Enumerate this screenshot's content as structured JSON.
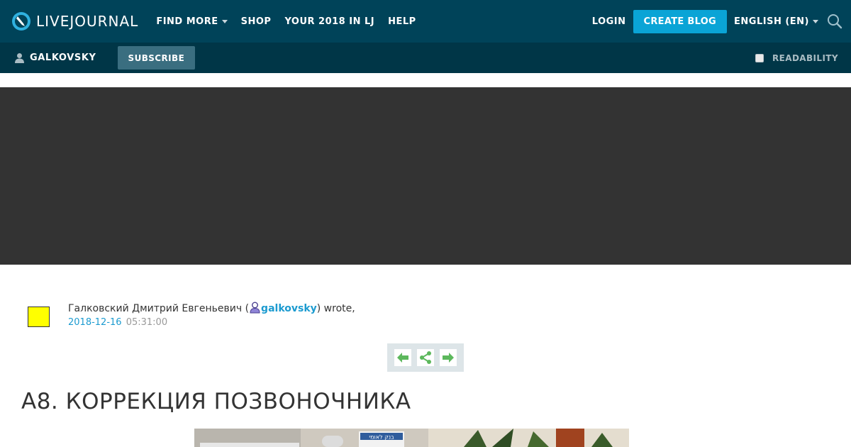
{
  "header": {
    "logo_text": "LIVEJOURNAL",
    "nav": [
      {
        "label": "FIND MORE",
        "has_dropdown": true
      },
      {
        "label": "SHOP",
        "has_dropdown": false
      },
      {
        "label": "YOUR 2018 IN LJ",
        "has_dropdown": false
      },
      {
        "label": "HELP",
        "has_dropdown": false
      }
    ],
    "login_label": "LOGIN",
    "create_blog_label": "CREATE BLOG",
    "language_label": "ENGLISH (EN)"
  },
  "subbar": {
    "journal_name": "GALKOVSKY",
    "subscribe_label": "SUBSCRIBE",
    "readability_label": "READABILITY",
    "readability_checked": false
  },
  "entry": {
    "author_fullname_prefix": "Галковский Дмитрий Евгеньевич (",
    "author_username": "galkovsky",
    "author_suffix": ") wrote,",
    "date": "2018-12-16",
    "time": "05:31:00",
    "title": "А8. КОРРЕКЦИЯ ПОЗВОНОЧНИКА",
    "image_caption_text": "בנק לאומי"
  },
  "icons": {
    "logo": "livejournal-logo-icon",
    "search": "search-icon",
    "user": "user-icon",
    "prev": "arrow-left-icon",
    "share": "share-icon",
    "next": "arrow-right-icon"
  },
  "colors": {
    "topbar": "#004359",
    "subbar": "#003647",
    "accent": "#0aa4d6",
    "link": "#1c9bd0",
    "banner": "#333333",
    "userpic": "#ffff00",
    "control_arrows": "#5cb85c"
  }
}
